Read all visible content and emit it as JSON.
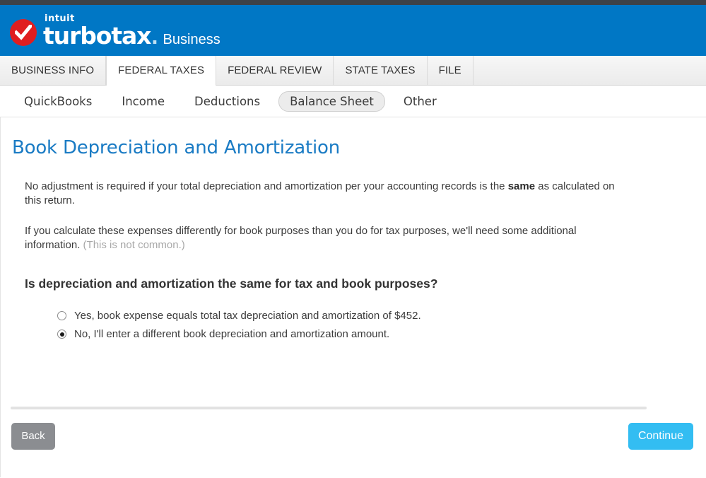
{
  "brand": {
    "intuit": "intuit",
    "product": "turbotax",
    "dot": ".",
    "edition": "Business",
    "logo_icon": "red-check-circle-icon",
    "header_color": "#0077c5",
    "logo_color": "#e01e20"
  },
  "primary_tabs": [
    {
      "label": "BUSINESS INFO",
      "active": false
    },
    {
      "label": "FEDERAL TAXES",
      "active": true
    },
    {
      "label": "FEDERAL REVIEW",
      "active": false
    },
    {
      "label": "STATE TAXES",
      "active": false
    },
    {
      "label": "FILE",
      "active": false
    }
  ],
  "sub_nav": [
    {
      "label": "QuickBooks",
      "selected": false
    },
    {
      "label": "Income",
      "selected": false
    },
    {
      "label": "Deductions",
      "selected": false
    },
    {
      "label": "Balance Sheet",
      "selected": true
    },
    {
      "label": "Other",
      "selected": false
    }
  ],
  "main": {
    "title": "Book Depreciation and Amortization",
    "title_color": "#1a7bc4",
    "paragraph_1": {
      "part_1": "No adjustment is required if your total depreciation and amortization per your accounting records is the ",
      "bold": "same",
      "part_2": " as calculated on this return."
    },
    "paragraph_2": {
      "part_1": "If you calculate these expenses differently for book purposes than you do for tax purposes, we'll need some additional information. ",
      "muted": "(This is not common.)"
    },
    "question": "Is depreciation and amortization the same for tax and book purposes?",
    "options": [
      {
        "label": "Yes, book expense equals total tax depreciation and amortization of $452.",
        "selected": false,
        "amount": "$452"
      },
      {
        "label": "No, I'll enter a different book depreciation and amortization amount.",
        "selected": true
      }
    ]
  },
  "footer": {
    "back_label": "Back",
    "continue_label": "Continue",
    "back_color": "#8b8d91",
    "continue_color": "#33bdf2"
  }
}
